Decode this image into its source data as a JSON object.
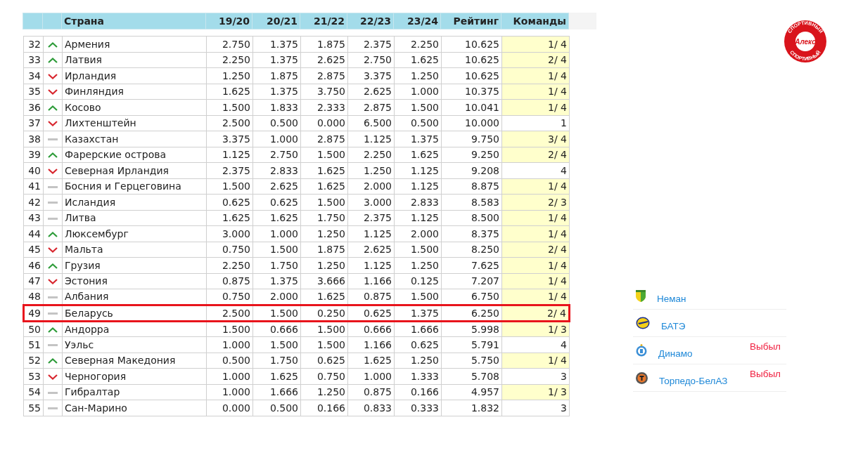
{
  "table": {
    "columns": [
      "",
      "",
      "Страна",
      "19/20",
      "20/21",
      "21/22",
      "22/23",
      "23/24",
      "Рейтинг",
      "Команды"
    ],
    "rows": [
      {
        "rank": "32",
        "kind": "up",
        "country": "Армения",
        "seasons": [
          "2.750",
          "1.375",
          "1.875",
          "2.375",
          "2.250"
        ],
        "rating": "10.625",
        "teams": "1/ 4",
        "teams_highlighted": true,
        "selected": false
      },
      {
        "rank": "33",
        "kind": "up",
        "country": "Латвия",
        "seasons": [
          "2.250",
          "1.375",
          "2.625",
          "2.750",
          "1.625"
        ],
        "rating": "10.625",
        "teams": "2/ 4",
        "teams_highlighted": true,
        "selected": false
      },
      {
        "rank": "34",
        "kind": "down",
        "country": "Ирландия",
        "seasons": [
          "1.250",
          "1.875",
          "2.875",
          "3.375",
          "1.250"
        ],
        "rating": "10.625",
        "teams": "1/ 4",
        "teams_highlighted": true,
        "selected": false
      },
      {
        "rank": "35",
        "kind": "down",
        "country": "Финляндия",
        "seasons": [
          "1.625",
          "1.375",
          "3.750",
          "2.625",
          "1.000"
        ],
        "rating": "10.375",
        "teams": "1/ 4",
        "teams_highlighted": true,
        "selected": false
      },
      {
        "rank": "36",
        "kind": "up",
        "country": "Косово",
        "seasons": [
          "1.500",
          "1.833",
          "2.333",
          "2.875",
          "1.500"
        ],
        "rating": "10.041",
        "teams": "1/ 4",
        "teams_highlighted": true,
        "selected": false
      },
      {
        "rank": "37",
        "kind": "down",
        "country": "Лихтенштейн",
        "seasons": [
          "2.500",
          "0.500",
          "0.000",
          "6.500",
          "0.500"
        ],
        "rating": "10.000",
        "teams": "1",
        "teams_highlighted": false,
        "selected": false
      },
      {
        "rank": "38",
        "kind": "same",
        "country": "Казахстан",
        "seasons": [
          "3.375",
          "1.000",
          "2.875",
          "1.125",
          "1.375"
        ],
        "rating": "9.750",
        "teams": "3/ 4",
        "teams_highlighted": true,
        "selected": false
      },
      {
        "rank": "39",
        "kind": "up",
        "country": "Фарерские острова",
        "seasons": [
          "1.125",
          "2.750",
          "1.500",
          "2.250",
          "1.625"
        ],
        "rating": "9.250",
        "teams": "2/ 4",
        "teams_highlighted": true,
        "selected": false
      },
      {
        "rank": "40",
        "kind": "down",
        "country": "Северная Ирландия",
        "seasons": [
          "2.375",
          "2.833",
          "1.625",
          "1.250",
          "1.125"
        ],
        "rating": "9.208",
        "teams": "4",
        "teams_highlighted": false,
        "selected": false
      },
      {
        "rank": "41",
        "kind": "same",
        "country": "Босния и Герцеговина",
        "seasons": [
          "1.500",
          "2.625",
          "1.625",
          "2.000",
          "1.125"
        ],
        "rating": "8.875",
        "teams": "1/ 4",
        "teams_highlighted": true,
        "selected": false
      },
      {
        "rank": "42",
        "kind": "same",
        "country": "Исландия",
        "seasons": [
          "0.625",
          "0.625",
          "1.500",
          "3.000",
          "2.833"
        ],
        "rating": "8.583",
        "teams": "2/ 3",
        "teams_highlighted": true,
        "selected": false
      },
      {
        "rank": "43",
        "kind": "same",
        "country": "Литва",
        "seasons": [
          "1.625",
          "1.625",
          "1.750",
          "2.375",
          "1.125"
        ],
        "rating": "8.500",
        "teams": "1/ 4",
        "teams_highlighted": true,
        "selected": false
      },
      {
        "rank": "44",
        "kind": "up",
        "country": "Люксембург",
        "seasons": [
          "3.000",
          "1.000",
          "1.250",
          "1.125",
          "2.000"
        ],
        "rating": "8.375",
        "teams": "1/ 4",
        "teams_highlighted": true,
        "selected": false
      },
      {
        "rank": "45",
        "kind": "down",
        "country": "Мальта",
        "seasons": [
          "0.750",
          "1.500",
          "1.875",
          "2.625",
          "1.500"
        ],
        "rating": "8.250",
        "teams": "2/ 4",
        "teams_highlighted": true,
        "selected": false
      },
      {
        "rank": "46",
        "kind": "up",
        "country": "Грузия",
        "seasons": [
          "2.250",
          "1.750",
          "1.250",
          "1.125",
          "1.250"
        ],
        "rating": "7.625",
        "teams": "1/ 4",
        "teams_highlighted": true,
        "selected": false
      },
      {
        "rank": "47",
        "kind": "down",
        "country": "Эстония",
        "seasons": [
          "0.875",
          "1.375",
          "3.666",
          "1.166",
          "0.125"
        ],
        "rating": "7.207",
        "teams": "1/ 4",
        "teams_highlighted": true,
        "selected": false
      },
      {
        "rank": "48",
        "kind": "same",
        "country": "Албания",
        "seasons": [
          "0.750",
          "2.000",
          "1.625",
          "0.875",
          "1.500"
        ],
        "rating": "6.750",
        "teams": "1/ 4",
        "teams_highlighted": true,
        "selected": false
      },
      {
        "rank": "49",
        "kind": "same",
        "country": "Беларусь",
        "seasons": [
          "2.500",
          "1.500",
          "0.250",
          "0.625",
          "1.375"
        ],
        "rating": "6.250",
        "teams": "2/ 4",
        "teams_highlighted": true,
        "selected": true
      },
      {
        "rank": "50",
        "kind": "up",
        "country": "Андорра",
        "seasons": [
          "1.500",
          "0.666",
          "1.500",
          "0.666",
          "1.666"
        ],
        "rating": "5.998",
        "teams": "1/ 3",
        "teams_highlighted": true,
        "selected": false
      },
      {
        "rank": "51",
        "kind": "same",
        "country": "Уэльс",
        "seasons": [
          "1.000",
          "1.500",
          "1.500",
          "1.166",
          "0.625"
        ],
        "rating": "5.791",
        "teams": "4",
        "teams_highlighted": false,
        "selected": false
      },
      {
        "rank": "52",
        "kind": "up",
        "country": "Северная Македония",
        "seasons": [
          "0.500",
          "1.750",
          "0.625",
          "1.625",
          "1.250"
        ],
        "rating": "5.750",
        "teams": "1/ 4",
        "teams_highlighted": true,
        "selected": false
      },
      {
        "rank": "53",
        "kind": "down",
        "country": "Черногория",
        "seasons": [
          "1.000",
          "1.625",
          "0.750",
          "1.000",
          "1.333"
        ],
        "rating": "5.708",
        "teams": "3",
        "teams_highlighted": false,
        "selected": false
      },
      {
        "rank": "54",
        "kind": "same",
        "country": "Гибралтар",
        "seasons": [
          "1.000",
          "1.666",
          "1.250",
          "0.875",
          "0.166"
        ],
        "rating": "4.957",
        "teams": "1/ 3",
        "teams_highlighted": true,
        "selected": false
      },
      {
        "rank": "55",
        "kind": "same",
        "country": "Сан-Марино",
        "seasons": [
          "0.000",
          "0.500",
          "0.166",
          "0.833",
          "0.333"
        ],
        "rating": "1.832",
        "teams": "3",
        "teams_highlighted": false,
        "selected": false
      }
    ]
  },
  "logo": {
    "center_text": "Алекс",
    "ring_top": "СПОРТИВНЫЙ",
    "ring_bottom": "СПОРТИВНЫЙ"
  },
  "clubs": [
    {
      "name": "Неман"
    },
    {
      "name": "БАТЭ"
    },
    {
      "name": "Динамо",
      "status": "Выбыл"
    },
    {
      "name": "Торпедо-БелАЗ",
      "status": "Выбыл"
    }
  ]
}
